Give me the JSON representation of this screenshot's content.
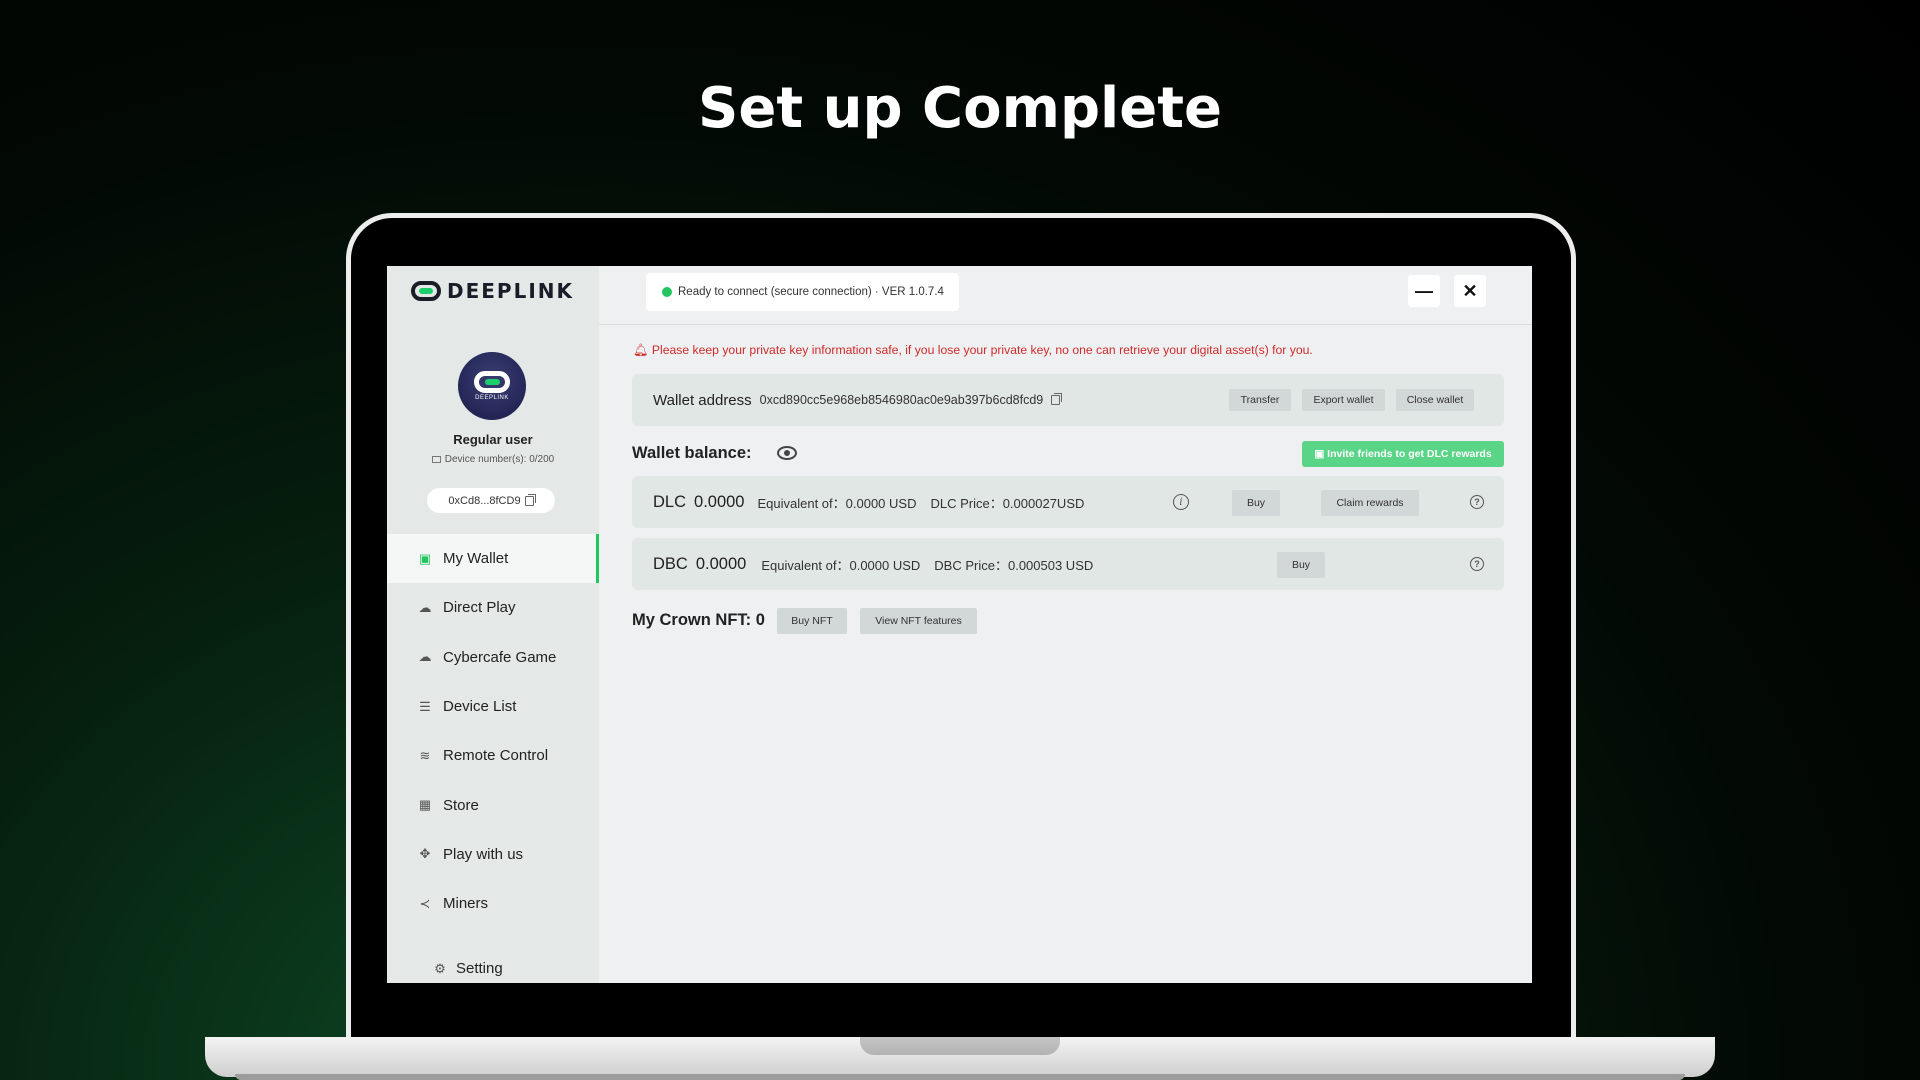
{
  "headline": "Set up Complete",
  "app": {
    "logo_text": "DEEPLINK",
    "status_text": "Ready to connect (secure connection) · VER 1.0.7.4",
    "minimize_symbol": "—",
    "close_symbol": "✕"
  },
  "sidebar": {
    "avatar_text": "DEEPLINK",
    "user_type": "Regular user",
    "device_number": "Device number(s): 0/200",
    "address_short": "0xCd8...8fCD9",
    "items": [
      {
        "label": "My Wallet",
        "icon": "wallet-icon",
        "glyph": "▣"
      },
      {
        "label": "Direct Play",
        "icon": "cloud-icon",
        "glyph": "☁"
      },
      {
        "label": "Cybercafe Game",
        "icon": "cloud-icon",
        "glyph": "☁"
      },
      {
        "label": "Device List",
        "icon": "list-icon",
        "glyph": "☰"
      },
      {
        "label": "Remote Control",
        "icon": "wifi-icon",
        "glyph": "≋"
      },
      {
        "label": "Store",
        "icon": "store-icon",
        "glyph": "▦"
      },
      {
        "label": "Play with us",
        "icon": "gamepad-icon",
        "glyph": "✥"
      },
      {
        "label": "Miners",
        "icon": "share-icon",
        "glyph": "≺"
      }
    ],
    "setting_label": "Setting",
    "setting_glyph": "⚙"
  },
  "main": {
    "warning": "Please keep your private key information safe, if you lose your private key, no one can retrieve your digital asset(s) for you.",
    "wallet_address_label": "Wallet address",
    "wallet_address": "0xcd890cc5e968eb8546980ac0e9ab397b6cd8fcd9",
    "transfer_label": "Transfer",
    "export_label": "Export wallet",
    "close_wallet_label": "Close wallet",
    "balance_title": "Wallet balance:",
    "invite_label": "Invite friends to get DLC rewards",
    "dlc": {
      "coin": "DLC",
      "amount": "0.0000",
      "equivalent": "Equivalent of：0.0000 USD",
      "price": "DLC Price：0.000027USD",
      "buy_label": "Buy",
      "claim_label": "Claim rewards"
    },
    "dbc": {
      "coin": "DBC",
      "amount": "0.0000",
      "equivalent": "Equivalent of：0.0000 USD",
      "price": "DBC Price：0.000503 USD",
      "buy_label": "Buy"
    },
    "nft_title": "My Crown NFT: 0",
    "buy_nft_label": "Buy NFT",
    "view_nft_label": "View NFT features"
  },
  "colors": {
    "accent_green": "#22c55e",
    "warning_red": "#cf2a2a",
    "invite_green": "#5ad486"
  }
}
